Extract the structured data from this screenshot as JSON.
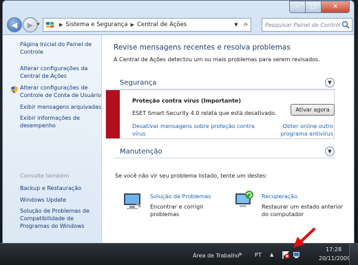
{
  "window": {
    "minimize": "–",
    "maximize": "□",
    "close": "✕"
  },
  "nav": {
    "back": "◀",
    "forward": "▶",
    "dropdown": "▾",
    "crumbs": [
      "Sistema e Segurança",
      "Central de Ações"
    ],
    "search_placeholder": "Pesquisar Painel de Controle"
  },
  "sidebar": {
    "items": [
      {
        "label": "Página Inicial do Painel de Controle"
      },
      {
        "label": "Alterar configurações da Central de Ações"
      },
      {
        "label": "Alterar configurações de Controle de Conta de Usuário"
      },
      {
        "label": "Exibir mensagens arquivadas"
      },
      {
        "label": "Exibir informações de desempenho"
      }
    ],
    "see_also": "Consulte também",
    "links": [
      {
        "label": "Backup e Restauração"
      },
      {
        "label": "Windows Update"
      },
      {
        "label": "Solução de Problemas de Compatibilidade de Programas do Windows"
      }
    ]
  },
  "main": {
    "title": "Revise mensagens recentes e resolva problemas",
    "subtitle": "A Central de Ações detectou um ou mais problemas para serem revisados.",
    "security": {
      "heading": "Segurança",
      "alert_title": "Proteção contra vírus  (Importante)",
      "alert_desc": "ESET Smart Security 4.0 relata que está desativado.",
      "button": "Ativar agora",
      "link1": "Desativar mensagens sobre proteção contra vírus",
      "link2": "Obter online outro programa antivírus",
      "color": "#b10e1e"
    },
    "maintenance": {
      "heading": "Manutenção"
    },
    "hint": "Se você não vir seu problema listado, tente um destes:",
    "tools": [
      {
        "title": "Solução de Problemas",
        "desc": "Encontrar e corrigir problemas"
      },
      {
        "title": "Recuperação",
        "desc": "Restaurar um estado anterior do computador"
      }
    ]
  },
  "taskbar": {
    "toolbar": "Área de Trabalho",
    "toolbar_arrow": "»",
    "lang": "PT",
    "tray_arrow": "▲",
    "time": "17:28",
    "date": "20/11/2009"
  },
  "colors": {
    "link": "#1e64b4",
    "heading": "#1e3b6e",
    "annotation_arrow": "#e01010"
  }
}
